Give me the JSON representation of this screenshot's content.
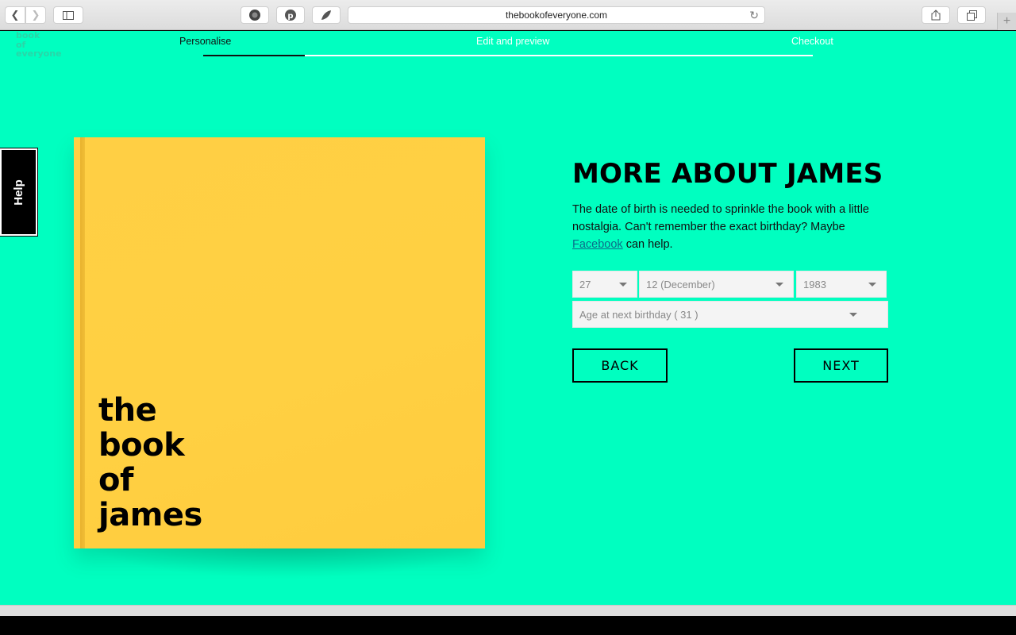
{
  "browser": {
    "url": "thebookofeveryone.com",
    "back_icon": "chevron-left",
    "forward_icon": "chevron-right",
    "sidebar_icon": "sidebar",
    "reload_icon": "reload",
    "share_icon": "share",
    "tabs_icon": "tabs",
    "newtab_icon": "plus"
  },
  "logo": {
    "line1": "book",
    "line2": "of",
    "line3": "everyone"
  },
  "steps": [
    {
      "label": "Personalise",
      "active": true
    },
    {
      "label": "Edit and preview",
      "active": false
    },
    {
      "label": "Checkout",
      "active": false
    }
  ],
  "progress_fraction": 0.167,
  "help": {
    "label": "Help"
  },
  "book": {
    "line1": "the",
    "line2": "book",
    "line3": "of",
    "line4": "james",
    "cover_color": "#ffcf44"
  },
  "form": {
    "heading": "MORE ABOUT JAMES",
    "desc_before": "The date of birth is needed to sprinkle the book with a little nostalgia. Can't remember the exact birthday? Maybe ",
    "desc_link": "Facebook",
    "desc_after": " can help.",
    "day": "27",
    "month": "12 (December)",
    "year": "1983",
    "age": "Age at next birthday ( 31 )",
    "back_label": "BACK",
    "next_label": "NEXT"
  },
  "colors": {
    "page_bg": "#00ffc0",
    "accent": "#000000",
    "link": "#0b6e8a"
  }
}
